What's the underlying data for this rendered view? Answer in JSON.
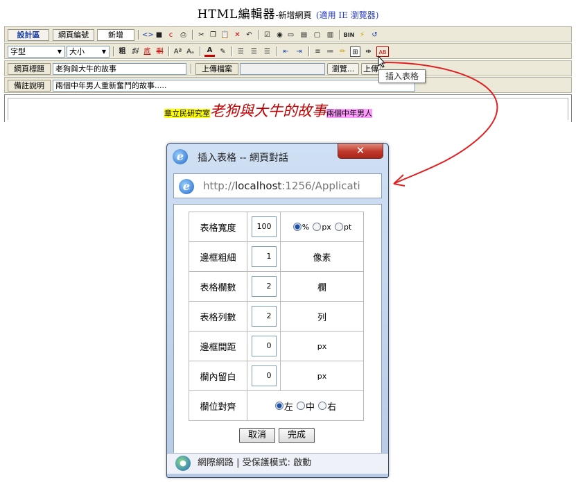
{
  "page": {
    "title_main": "HTML編輯器",
    "title_sub": "-新增網頁",
    "title_note": "(適用 IE 瀏覽器)"
  },
  "toolbar1": {
    "design_tab": "設計區",
    "code_tab": "網頁編號",
    "new_button": "新增",
    "icons": [
      "code-view-icon",
      "save-icon",
      "copy-c-icon",
      "print-icon",
      "cut-icon",
      "copy-icon",
      "paste-icon",
      "delete-icon",
      "undo-icon",
      "checkbox-icon",
      "radio-icon",
      "textbox-icon",
      "textarea-icon",
      "button-icon",
      "select-icon",
      "bin-icon",
      "flash-icon",
      "refresh-icon"
    ]
  },
  "toolbar2": {
    "font_select": "字型",
    "size_select": "大小",
    "icons": [
      "bold-icon",
      "italic-icon",
      "underline-icon",
      "strike-icon",
      "superscript-icon",
      "subscript-icon",
      "font-color-icon",
      "highlight-icon",
      "align-left-icon",
      "align-center-icon",
      "align-right-icon",
      "outdent-icon",
      "indent-icon",
      "ordered-list-icon",
      "unordered-list-icon",
      "pencil-icon",
      "insert-table-icon",
      "hr-icon",
      "abc-icon"
    ]
  },
  "title_row": {
    "label": "網頁標題",
    "value": "老狗與大牛的故事",
    "upload_label": "上傳檔案",
    "browse_button": "瀏覽...",
    "upload_button": "上傳"
  },
  "note_row": {
    "label": "備註說明",
    "value": "兩個中年男人重新奮鬥的故事....."
  },
  "editor": {
    "tag1": "章立民研究室",
    "headline": "老狗與大牛的故事",
    "tag2": "兩個中年男人"
  },
  "tooltip": "插入表格",
  "colors": {
    "arrow": "#e02020",
    "tab_blue": "#1b3fa8"
  },
  "dialog": {
    "title": "插入表格 -- 網頁對話",
    "close": "✕",
    "url_prefix": "http://",
    "url_host": "localhost",
    "url_rest": ":1256/Applicati",
    "rows": [
      {
        "label": "表格寬度",
        "value": "100"
      },
      {
        "label": "邊框粗細",
        "value": "1",
        "unit": "像素"
      },
      {
        "label": "表格欄數",
        "value": "2",
        "unit": "欄"
      },
      {
        "label": "表格列數",
        "value": "2",
        "unit": "列"
      },
      {
        "label": "邊框間距",
        "value": "0",
        "unit": "px"
      },
      {
        "label": "欄內留白",
        "value": "0",
        "unit": "px"
      }
    ],
    "width_units": [
      "%",
      "px",
      "pt"
    ],
    "align_label": "欄位對齊",
    "align_options": [
      "左",
      "中",
      "右"
    ],
    "cancel_button": "取消",
    "done_button": "完成",
    "status": "網際網路 | 受保護模式: 啟動"
  }
}
